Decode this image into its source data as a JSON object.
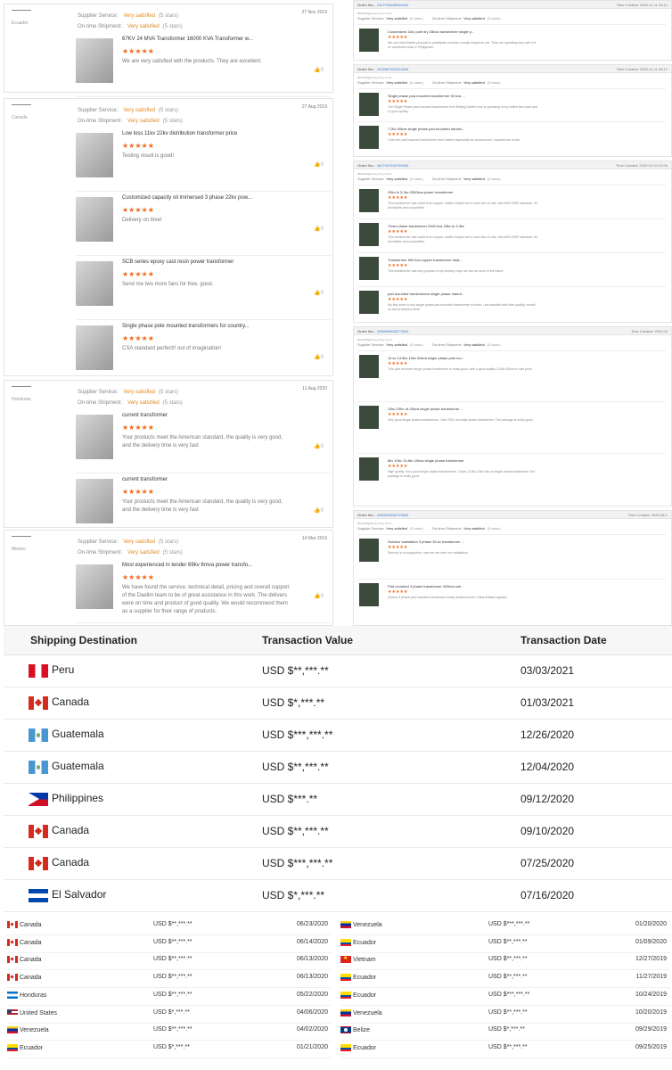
{
  "labels": {
    "supplier_service": "Supplier Service:",
    "ontime": "On-time Shipment:",
    "very_satisfied": "Very satisfied",
    "five_stars": "(5 stars)",
    "stars": "★★★★★",
    "like": "0",
    "order_no": "Order No.:",
    "time_created": "Time Created:"
  },
  "left_reviews": [
    {
      "country": "Ecuador",
      "date": "27 Nov 2019",
      "products": [
        {
          "title": "67KV 24 MVA Transformer 16000 KVA Transformer w...",
          "desc": "We are very satisfied with the products. They are excellent."
        }
      ]
    },
    {
      "country": "Canada",
      "date": "27 Aug 2019",
      "products": [
        {
          "title": "Low loss 11kv 22kv distribution transformer price",
          "desc": "Testing result is good!"
        },
        {
          "title": "Customized capacity oil immersed 3 phase 22kv pow...",
          "desc": "Delivery on time!"
        },
        {
          "title": "SCB series epoxy cast resin power transformer",
          "desc": "Send me two more fans for free, good."
        },
        {
          "title": "Single phase pole mounted transformers for country...",
          "desc": "CSA standard perfect!! out of imagination!"
        }
      ]
    },
    {
      "country": "Honduras",
      "date": "11 Aug 2020",
      "products": [
        {
          "title": "current transformer",
          "desc": "Your products meet the American standard, the quality is very good, and the delivery time is very fast"
        },
        {
          "title": "current transformer",
          "desc": "Your products meet the American standard, the quality is very good, and the delivery time is very fast"
        }
      ]
    },
    {
      "country": "Mexico",
      "date": "14 Mar 2019",
      "products": [
        {
          "title": "Most experienced in tender 69kv 6mva power transfo...",
          "desc": "We have found the service, technical detail, pricing and overall support of the Daelim team to be of great assistance in this work. The delivers were on time and product of good quality. We would recommend them as a supplier for their range of products."
        }
      ]
    }
  ],
  "right_orders": [
    {
      "order": "2207753485326426",
      "time": "Time Created: 2020-11-11 05:14",
      "buyer": "BM-D6M@Hong Kong S.A.R.",
      "products": [
        {
          "title": "Customized 11kv pole dry 25kva transformer single p...",
          "desc": "We can trust Daelim physical to participate a tender a really helpful as are. They are operating very well in it on scheduled tests in Philippines."
        }
      ]
    },
    {
      "order": "2205967810324626",
      "time": "Time Created: 2020-11-11 05:12",
      "buyer": "BM-D6M@Hong Kong S.A.R.",
      "products": [
        {
          "title": "Single phase pad-mounted transformer 50 kva ...",
          "desc": "The Single Phase pad-mounted transformer from Beijing Daelim now is operating in my coffee farm park and in good quality."
        },
        {
          "title": "7.2kv 50kva single phase pad-mounted transfo...",
          "desc": "I love this pad mounted transformer from Daelim especially the accessories I required are worth."
        }
      ]
    },
    {
      "order": "4627347620750626",
      "time": "Time Created: 2020-10-04 22:06",
      "buyer": "BM-D6M@Hong Kong S.A.R.",
      "products": [
        {
          "title": "20kv to 3.3kv 2500kva power transformer",
          "desc": "This transformer was made from copper, daelim helped me to save lots of cost, with ANSI IEEE standard, it's all reliable and competitive."
        },
        {
          "title": "Three phase transformer 2500 kva 33kv to 3.3kv",
          "desc": "This transformer was made from copper, daelim helped me to save lots of cost, with ANSI IEEE standard, it's all reliable and competitive."
        },
        {
          "title": "Transformer 500 kva copper transformer total...",
          "desc": "This transformer was very popular in my country, hope we can do more in the future~"
        },
        {
          "title": "pad mounted transformers single phase manuf...",
          "desc": "My first order to buy single phase pad mounted transformer in china. I am satisfied with their quality, overall ok and production time!"
        }
      ]
    },
    {
      "order": "2086999628272626",
      "time": "Time Created: 2020-09",
      "buyer": "BM-D6M@Hong Kong S.A.R.",
      "products": [
        {
          "title": "14 kv 13.8kv 10kv 50kva single phase pole mo...",
          "desc": "This pole mounted single phase transformer is really good, with a good quality 13.8kv 50kva is nice price"
        },
        {
          "title": "10kv 230v oil 25kva single phase transformer ...",
          "desc": "Very good single phase transformers, 10kv 230v oil single phase transformer. The package is really good."
        },
        {
          "title": "8kv 10kv 13.8kv 10kva single phase transformer",
          "desc": "High quality. Very good single phase transformers, 10kva 13.8kv 10kv 8kv oil single phase transformer The package is really good."
        }
      ]
    },
    {
      "order": "2089943630729626",
      "time": "Time Created: 2020-08-1",
      "buyer": "BM-D6M@Hong Kong S.A.R.",
      "products": [
        {
          "title": "Outdoor substation 3 phase 35 kv transformer ...",
          "desc": "Delivery is so supportive, now we can start our installation."
        },
        {
          "title": "Pad mounted 3 phase transformer 200kva sub...",
          "desc": "200kva 3 phase pad-mounted transformer finally delivered from China brilliant logistics."
        }
      ]
    }
  ],
  "table": {
    "headers": [
      "Shipping Destination",
      "Transaction Value",
      "Transaction Date"
    ],
    "rows": [
      {
        "flag": "peru",
        "country": "Peru",
        "value": "USD $**,***.**",
        "date": "03/03/2021"
      },
      {
        "flag": "canada",
        "country": "Canada",
        "value": "USD $*,***.**",
        "date": "01/03/2021"
      },
      {
        "flag": "guate",
        "country": "Guatemala",
        "value": "USD $***,***.**",
        "date": "12/26/2020"
      },
      {
        "flag": "guate",
        "country": "Guatemala",
        "value": "USD $**,***.**",
        "date": "12/04/2020"
      },
      {
        "flag": "phil",
        "country": "Philippines",
        "value": "USD $***.**",
        "date": "09/12/2020"
      },
      {
        "flag": "canada",
        "country": "Canada",
        "value": "USD $**,***.**",
        "date": "09/10/2020"
      },
      {
        "flag": "canada",
        "country": "Canada",
        "value": "USD $***,***.**",
        "date": "07/25/2020"
      },
      {
        "flag": "els",
        "country": "El Salvador",
        "value": "USD $*,***.**",
        "date": "07/16/2020"
      }
    ]
  },
  "bottom_left": [
    {
      "flag": "canada",
      "country": "Canada",
      "value": "USD $**,***.**",
      "date": "06/23/2020"
    },
    {
      "flag": "canada",
      "country": "Canada",
      "value": "USD $**,***.**",
      "date": "06/14/2020"
    },
    {
      "flag": "canada",
      "country": "Canada",
      "value": "USD $**,***.**",
      "date": "06/13/2020"
    },
    {
      "flag": "canada",
      "country": "Canada",
      "value": "USD $**,***.**",
      "date": "06/13/2020"
    },
    {
      "flag": "hond",
      "country": "Honduras",
      "value": "USD $**,***.**",
      "date": "05/22/2020"
    },
    {
      "flag": "usa",
      "country": "United States",
      "value": "USD $*,***.**",
      "date": "04/06/2020"
    },
    {
      "flag": "ven",
      "country": "Venezuela",
      "value": "USD $**,***.**",
      "date": "04/02/2020"
    },
    {
      "flag": "ecu",
      "country": "Ecuador",
      "value": "USD $*,***.**",
      "date": "01/21/2020"
    }
  ],
  "bottom_right": [
    {
      "flag": "ven",
      "country": "Venezuela",
      "value": "USD $***,***.**",
      "date": "01/20/2020"
    },
    {
      "flag": "ecu",
      "country": "Ecuador",
      "value": "USD $**,***.**",
      "date": "01/09/2020"
    },
    {
      "flag": "viet",
      "country": "Vietnam",
      "value": "USD $**,***.**",
      "date": "12/27/2019"
    },
    {
      "flag": "ecu",
      "country": "Ecuador",
      "value": "USD $**,***.**",
      "date": "11/27/2019"
    },
    {
      "flag": "ecu",
      "country": "Ecuador",
      "value": "USD $***,***.**",
      "date": "10/24/2019"
    },
    {
      "flag": "ven",
      "country": "Venezuela",
      "value": "USD $**,***.**",
      "date": "10/20/2019"
    },
    {
      "flag": "belize",
      "country": "Belize",
      "value": "USD $*,***.**",
      "date": "09/29/2019"
    },
    {
      "flag": "ecu",
      "country": "Ecuador",
      "value": "USD $**,***.**",
      "date": "09/25/2019"
    }
  ]
}
